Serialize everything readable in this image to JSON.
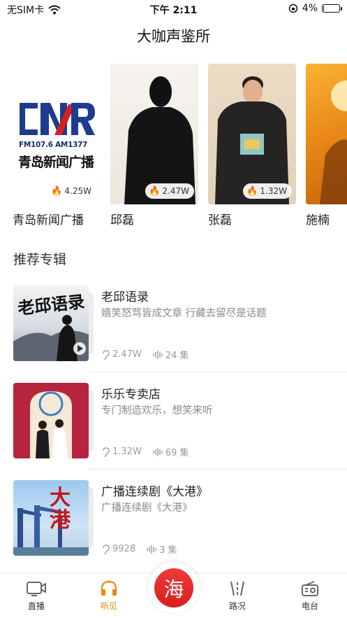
{
  "status_bar": {
    "carrier": "无SIM卡",
    "time": "下午 2:11",
    "battery_percent": "4%",
    "battery_level": 0.04
  },
  "nav": {
    "title": "大咖声鉴所"
  },
  "hosts": [
    {
      "name": "青岛新闻广播",
      "heat": "4.25W",
      "logo_freq": "FM107.6 AM1377",
      "logo_text": "青岛新闻广播"
    },
    {
      "name": "邱磊",
      "heat": "2.47W"
    },
    {
      "name": "张磊",
      "heat": "1.32W"
    },
    {
      "name": "施楠",
      "heat": ""
    }
  ],
  "section": {
    "title": "推荐专辑"
  },
  "albums": [
    {
      "cover_text": "老邱语录",
      "title": "老邱语录",
      "desc": "嬉笑怒骂皆成文章 行藏去留尽是话题",
      "plays": "2.47W",
      "episodes": "24 集"
    },
    {
      "title": "乐乐专卖店",
      "desc": "专门制造欢乐，想笑来听",
      "plays": "1.32W",
      "episodes": "69 集"
    },
    {
      "cover_text": "大港",
      "title": "广播连续剧《大港》",
      "desc": "广播连续剧《大港》",
      "plays": "9928",
      "episodes": "3 集"
    }
  ],
  "tabbar": {
    "tabs": [
      {
        "label": "直播",
        "icon": "video-camera-icon"
      },
      {
        "label": "听见",
        "icon": "headphones-icon",
        "active": true
      },
      {
        "label": "",
        "icon": "hai-logo-icon",
        "glyph": "海"
      },
      {
        "label": "路况",
        "icon": "traffic-icon"
      },
      {
        "label": "电台",
        "icon": "radio-icon"
      }
    ]
  },
  "colors": {
    "accent": "#f08300",
    "heat": "#e8342c",
    "logo_red": "#d81e1e"
  }
}
